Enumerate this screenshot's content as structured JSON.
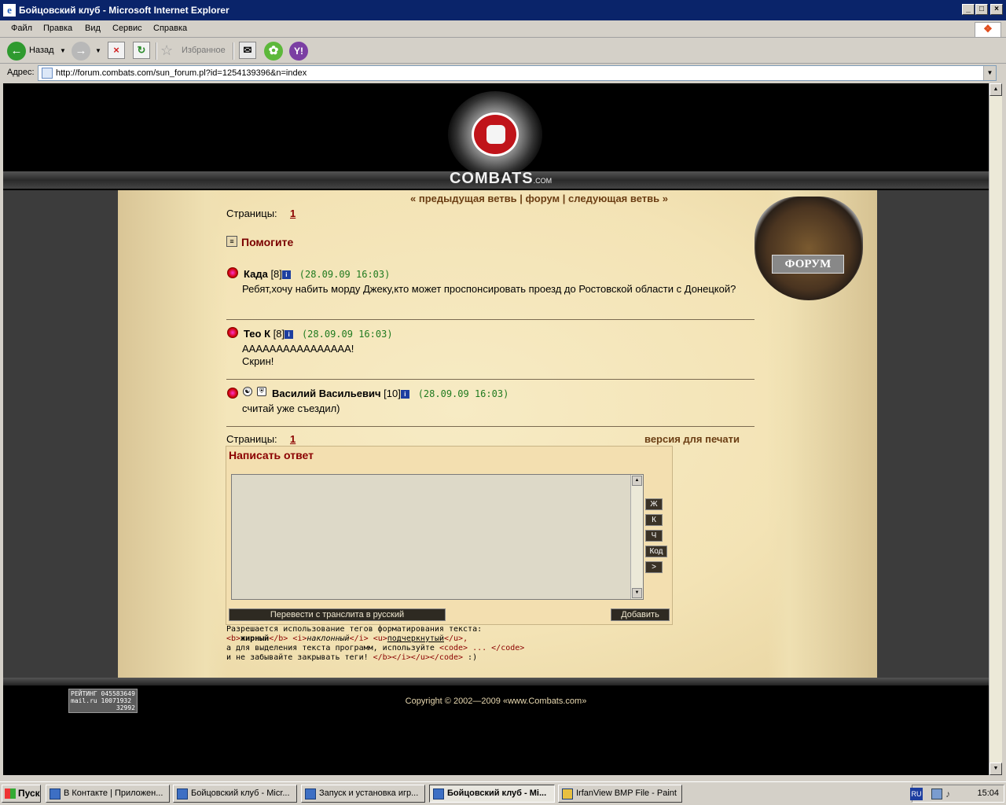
{
  "window": {
    "title": "Бойцовский клуб - Microsoft Internet Explorer",
    "min": "_",
    "max": "□",
    "close": "×"
  },
  "menu": [
    "Файл",
    "Правка",
    "Вид",
    "Сервис",
    "Справка"
  ],
  "toolbar": {
    "back_label": "Назад",
    "favorites_label": "Избранное"
  },
  "address": {
    "label": "Адрес:",
    "url": "http://forum.combats.com/sun_forum.pl?id=1254139396&n=index"
  },
  "site": {
    "brand": "COMBATS",
    "brand_suffix": ".COM",
    "forum_sign": "ФОРУМ"
  },
  "nav": {
    "prev": "« предыдущая ветвь",
    "sep": "|",
    "forum": "форум",
    "next": "следующая ветвь »"
  },
  "pages_label": "Страницы:",
  "page_number": "1",
  "topic_title": "Помогите",
  "posts": [
    {
      "author": "Када",
      "level": "[8]",
      "date": "(28.09.09 16:03)",
      "text": "Ребят,хочу набить морду Джеку,кто может проспонсировать проезд до Ростовской области с Донецкой?"
    },
    {
      "author": "Тео К",
      "level": "[8]",
      "date": "(28.09.09 16:03)",
      "text_line1": "АААААААААААААААА!",
      "text_line2": "Скрин!"
    },
    {
      "author": "Василий Васильевич",
      "level": "[10]",
      "date": "(28.09.09 16:03)",
      "text": "считай уже съездил)"
    }
  ],
  "print_version": "версия для печати",
  "reply": {
    "title": "Написать ответ",
    "buttons": [
      "Ж",
      "К",
      "Ч",
      "Код",
      ">"
    ],
    "translit_button": "Перевести с транслита в русский",
    "submit_button": "Добавить"
  },
  "help": {
    "line1": "Разрешается использование тегов форматирования текста:",
    "bold_tag_open": "<b>",
    "bold_word": "жирный",
    "bold_tag_close": "</b>",
    "italic_tag_open": "<i>",
    "italic_word": "наклонный",
    "italic_tag_close": "</i>",
    "underline_tag_open": "<u>",
    "underline_word": "подчеркнутый",
    "underline_tag_close": "</u>,",
    "line3_prefix": "а для выделения текста программ, используйте ",
    "line3_code": "<code> ... </code>",
    "line4_prefix": "и не забывайте закрывать теги! ",
    "line4_code": "</b></i></u></code>",
    "line4_suffix": " :)"
  },
  "footer": {
    "counter_line1": "РЕЙТИНГ 045583649",
    "counter_line2": "mail.ru 10071932",
    "counter_line3": "32992",
    "copyright": "Copyright © 2002—2009 «www.Combats.com»"
  },
  "taskbar": {
    "start": "Пуск",
    "tasks": [
      "В Контакте | Приложен...",
      "Бойцовский клуб - Micr...",
      "Запуск и установка игр...",
      "Бойцовский клуб - Mi...",
      "IrfanView BMP File - Paint"
    ],
    "lang": "RU",
    "clock": "15:04"
  }
}
